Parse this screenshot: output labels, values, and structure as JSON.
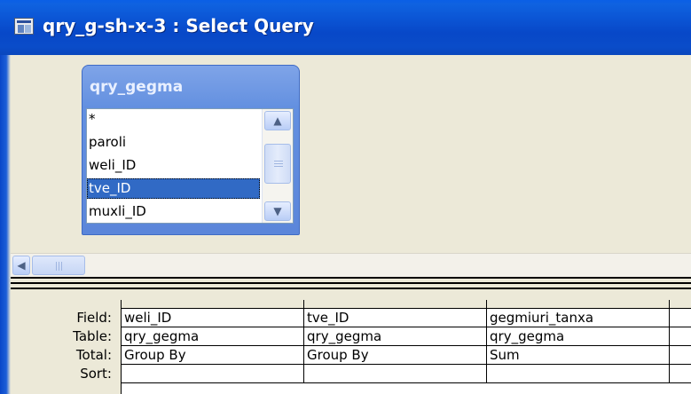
{
  "window": {
    "title": "qry_g-sh-x-3 : Select Query"
  },
  "field_list": {
    "title": "qry_gegma",
    "items": [
      "*",
      "paroli",
      "weli_ID",
      "tve_ID",
      "muxli_ID"
    ],
    "selected_item": "tve_ID"
  },
  "grid": {
    "row_labels": [
      "Field:",
      "Table:",
      "Total:",
      "Sort:"
    ],
    "columns": [
      {
        "field": "weli_ID",
        "table": "qry_gegma",
        "total": "Group By"
      },
      {
        "field": "tve_ID",
        "table": "qry_gegma",
        "total": "Group By"
      },
      {
        "field": "gegmiuri_tanxa",
        "table": "qry_gegma",
        "total": "Sum"
      }
    ]
  },
  "icons": {
    "window_icon": "query-icon",
    "scroll_up": "arrow-up-icon",
    "scroll_down": "arrow-down-icon",
    "scroll_left": "arrow-left-icon"
  },
  "colors": {
    "titlebar": "#0a52d2",
    "selection": "#316ac5",
    "workspace": "#ece9d8"
  }
}
